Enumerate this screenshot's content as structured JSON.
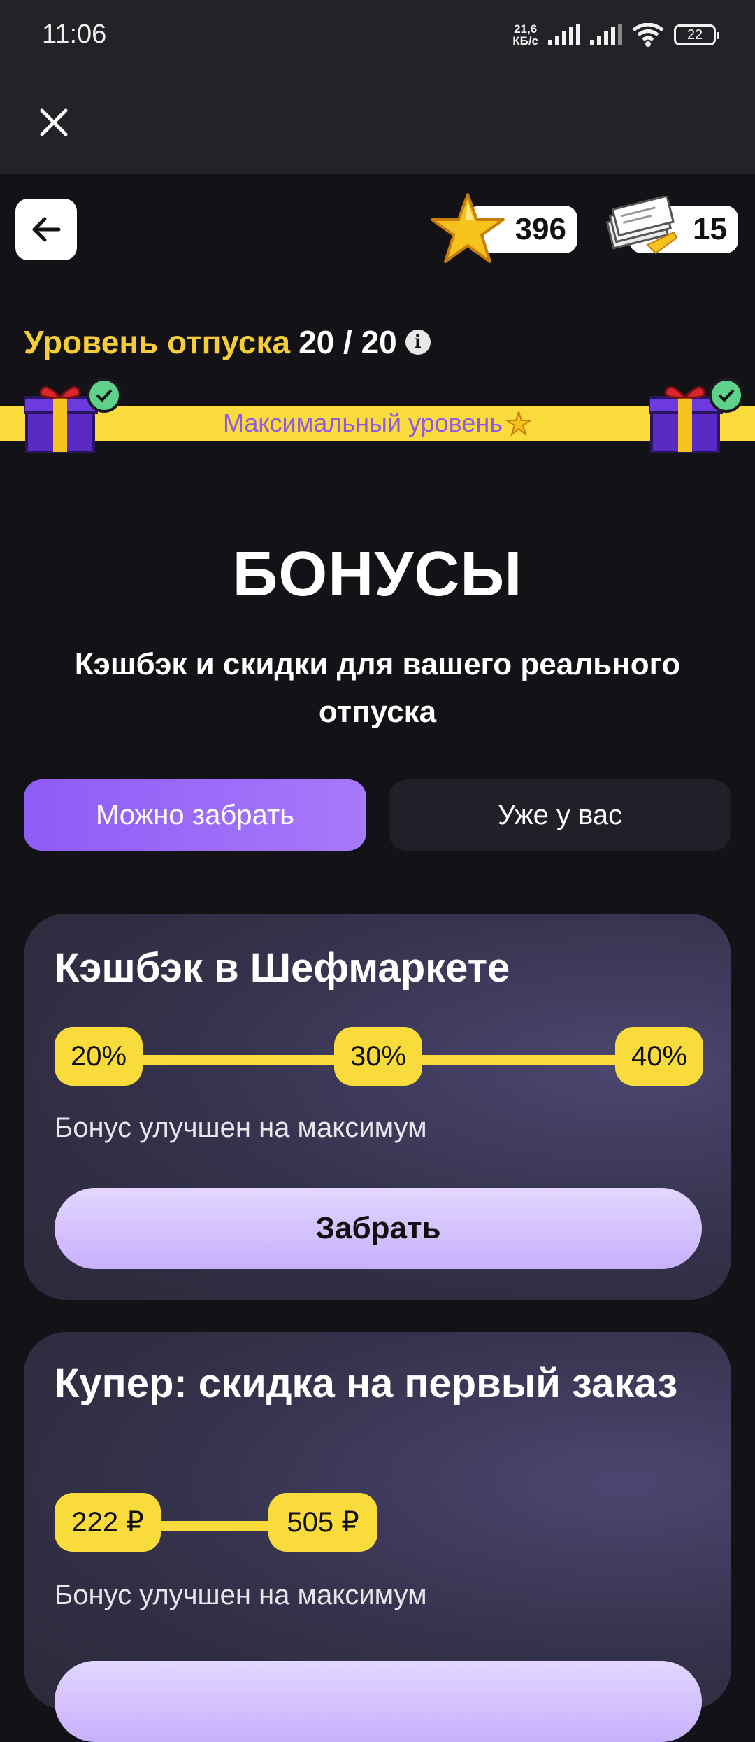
{
  "status_bar": {
    "time": "11:06",
    "net_speed_value": "21,6",
    "net_speed_unit": "КБ/с",
    "battery": "22"
  },
  "header": {
    "stars_count": "396",
    "tickets_count": "15"
  },
  "level": {
    "label": "Уровень отпуска",
    "value": "20 / 20",
    "progress_text": "Максимальный уровень",
    "progress_fraction": 1.0
  },
  "page": {
    "title": "БОНУСЫ",
    "subtitle": "Кэшбэк и скидки для вашего реального отпуска"
  },
  "tabs": [
    {
      "label": "Можно забрать",
      "active": true
    },
    {
      "label": "Уже у вас",
      "active": false
    }
  ],
  "bonuses": [
    {
      "title": "Кэшбэк в Шефмаркете",
      "tiers": [
        "20%",
        "30%",
        "40%"
      ],
      "note": "Бонус улучшен на максимум",
      "button": "Забрать"
    },
    {
      "title": "Купер: скидка на первый заказ",
      "tiers": [
        "222 ₽",
        "505 ₽"
      ],
      "note": "Бонус улучшен на максимум"
    }
  ],
  "colors": {
    "accent_yellow": "#f9dc3c",
    "accent_purple": "#8e5cf6",
    "background": "#131217"
  },
  "icons": [
    "close-icon",
    "back-arrow-icon",
    "star-icon",
    "ticket-icon",
    "info-icon",
    "gift-icon",
    "check-icon"
  ]
}
